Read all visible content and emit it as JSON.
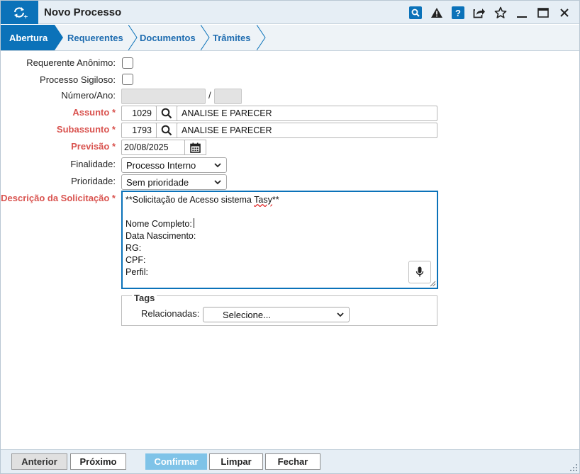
{
  "window": {
    "title": "Novo Processo",
    "accent_color": "#0b72b9",
    "app_icon": "refresh-plus-icon",
    "titlebar_icons": [
      "search-icon",
      "warning-icon",
      "help-icon",
      "share-icon",
      "star-icon",
      "minimize-icon",
      "maximize-icon",
      "close-icon"
    ]
  },
  "tabs": [
    {
      "label": "Abertura",
      "active": true
    },
    {
      "label": "Requerentes",
      "active": false
    },
    {
      "label": "Documentos",
      "active": false
    },
    {
      "label": "Trâmites",
      "active": false
    }
  ],
  "form": {
    "anonimo_label": "Requerente Anônimo:",
    "sigiloso_label": "Processo Sigiloso:",
    "numero_label": "Número/Ano:",
    "numero_separator": "/",
    "assunto_label": "Assunto *",
    "assunto_code": "1029",
    "assunto_desc": "ANALISE E PARECER",
    "subassunto_label": "Subassunto *",
    "subassunto_code": "1793",
    "subassunto_desc": "ANALISE E PARECER",
    "previsao_label": "Previsão *",
    "previsao_value": "20/08/2025",
    "finalidade_label": "Finalidade:",
    "finalidade_value": "Processo Interno",
    "prioridade_label": "Prioridade:",
    "prioridade_value": "Sem prioridade",
    "descricao_label": "Descrição da Solicitação *",
    "descricao_lines": {
      "l1a": "**Solicitação de Acesso sistema ",
      "l1b": "Tasy",
      "l1c": "**",
      "l3": "Nome Completo:",
      "l4": "Data Nascimento:",
      "l5": "RG:",
      "l6": "CPF:",
      "l7": "Perfil:"
    }
  },
  "tags": {
    "legend": "Tags",
    "relacionadas_label": "Relacionadas:",
    "select_value": "Selecione..."
  },
  "footer": {
    "anterior": "Anterior",
    "proximo": "Próximo",
    "confirmar": "Confirmar",
    "limpar": "Limpar",
    "fechar": "Fechar"
  }
}
